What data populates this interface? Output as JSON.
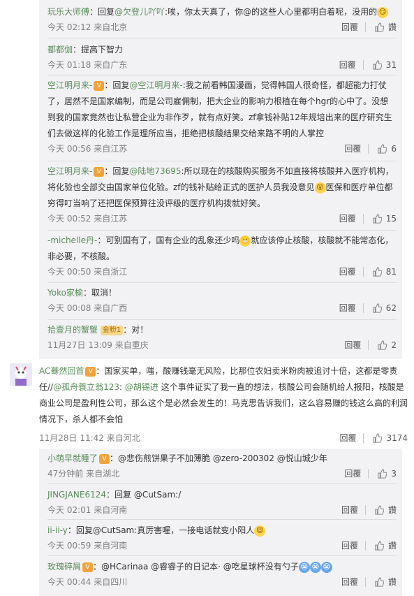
{
  "actions": {
    "reply_label": "回覆",
    "like_icon": "thumbs-up-icon"
  },
  "top_replies": [
    {
      "name": "玩乐大师傅",
      "prefix": "：回复",
      "at": "@欠登儿吖吖",
      "text": ":唉，你太天真了，你@的这些人心里都明白着呢，没用的",
      "time": "今天 02:12 来自北京",
      "likes": "讚",
      "emoji": "😏"
    },
    {
      "name": "都都伽",
      "text": "：提高下智力",
      "time": "今天 01:18 来自广东",
      "likes": "31"
    },
    {
      "name": "空江明月来-",
      "prefix": "：回复",
      "at": "@空江明月来-",
      "text": ":我之前看韩国漫画，觉得韩国人很奇怪，都超能力打仗了，居然不是国家编制，而是公司雇佣制，把大企业的影响力根植在每个hgr的心中了。没想到我的国家竟然也让私营企业为非作歹，就有点好笑。zf拿钱补贴12年规培出来的医疗研究生们去做这样的化验工作是理所应当，拒绝把核酸结果交给来路不明的人掌控",
      "time": "今天 00:56 来自江苏",
      "likes": "6"
    },
    {
      "name": "空江明月来-",
      "prefix": "：回复",
      "at": "@陆地73695",
      "text": ":所以现在的核酸购买服务不如直接将核酸并入医疗机构，将化验也全部交由国家单位化验。zf的钱补贴给正式的医护人员我没意见",
      "text2": "医保和医疗单位都穷得叮当响了还把医保预算往没评级的医疗机构拨就好笑。",
      "time": "今天 00:52 来自江苏",
      "likes": "15"
    },
    {
      "name": "-michelle丹-",
      "text": "：可别国有了，国有企业的乱象还少吗",
      "text2": "就应该停止核酸，核酸就不能常态化，非必要，不核酸。",
      "time": "今天 00:50 来自浙江",
      "likes": "81"
    },
    {
      "name": "Yoko家榆",
      "text": "：取消！",
      "time": "今天 00:08 来自广西",
      "likes": "62"
    },
    {
      "name": "拾壹月的蟹蟹",
      "badge": "金粉1",
      "text": "：对！",
      "time": "11月27日 13:09 来自重庆",
      "likes": "2"
    }
  ],
  "main_comment": {
    "name": "AC蓦然回首",
    "text_a": "：国家买单，嗤，酸赚钱毫无风险，比那位农妇卖米粉肉被追讨十倍，这都是零责任//",
    "mention1": "@孤舟蓑立翁123",
    "text_b": ": ",
    "mention2": "@胡锡进",
    "text_c": " 这个事件证实了我一直的想法，核酸公司会随机给人报阳，核酸是商业公司是盈利性公司，那么这个是必然会发生的！马克思告诉我们，这么容易赚的钱这么高的利润情况下，杀人都不会怕",
    "time": "11月28日 11:42 来自河北",
    "likes": "3174"
  },
  "bottom_replies": [
    {
      "name": "小萌早就睡了",
      "text": "：@悲伤煎饼果子不加薄脆 @zero-200302 @悦山城少年",
      "time": "47分钟前 来自湖北",
      "likes": "3"
    },
    {
      "name": "JINGJANE6124",
      "text": "：回复 @CutSam:/",
      "time": "今天 02:01 来自河南",
      "likes": "讚"
    },
    {
      "name": "ii-ii-y",
      "text": "：回复@CutSam:真厉害喔，一接电话就变小阳人",
      "time": "今天 00:59 来自河南",
      "likes": "讚"
    },
    {
      "name": "玫瑰碎屑",
      "text": "：@HCarinaa @睿睿子的日记本· @吃星球杯没有勺子",
      "time": "今天 00:44 来自四川",
      "likes": "讚"
    }
  ]
}
